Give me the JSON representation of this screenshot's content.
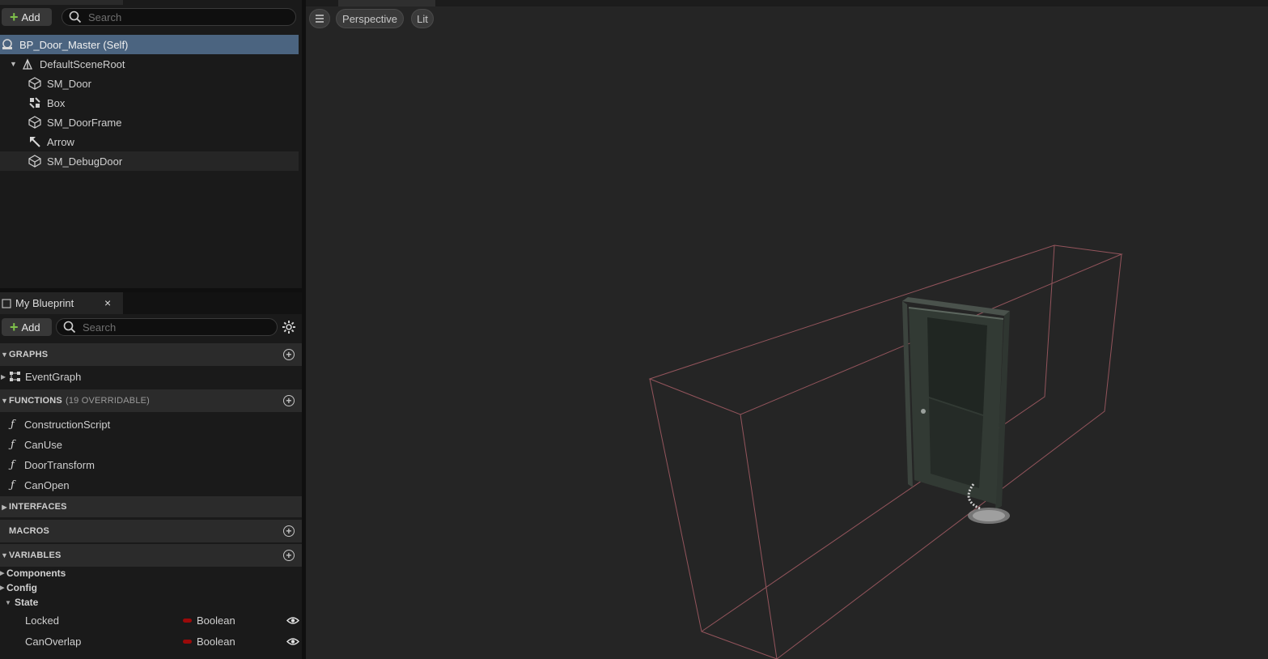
{
  "components_panel": {
    "add_label": "Add",
    "search_placeholder": "Search",
    "tree": [
      {
        "label": "BP_Door_Master (Self)",
        "icon": "actor-icon",
        "selected": true
      },
      {
        "label": "DefaultSceneRoot",
        "icon": "scene-root-icon"
      },
      {
        "label": "SM_Door",
        "icon": "static-mesh-icon"
      },
      {
        "label": "Box",
        "icon": "box-collision-icon"
      },
      {
        "label": "SM_DoorFrame",
        "icon": "static-mesh-icon"
      },
      {
        "label": "Arrow",
        "icon": "arrow-icon"
      },
      {
        "label": "SM_DebugDoor",
        "icon": "static-mesh-icon",
        "hovered": true
      }
    ]
  },
  "my_blueprint": {
    "tab_label": "My Blueprint",
    "close_glyph": "×",
    "add_label": "Add",
    "search_placeholder": "Search",
    "sections": {
      "graphs": "GRAPHS",
      "functions": "FUNCTIONS",
      "functions_note": "(19 OVERRIDABLE)",
      "interfaces": "INTERFACES",
      "macros": "MACROS",
      "variables": "VARIABLES"
    },
    "graphs": [
      "EventGraph"
    ],
    "functions": [
      "ConstructionScript",
      "CanUse",
      "DoorTransform",
      "CanOpen"
    ],
    "variable_categories": [
      "Components",
      "Config",
      "State"
    ],
    "variables": [
      {
        "name": "Locked",
        "type": "Boolean",
        "type_color": "#9b0a0a"
      },
      {
        "name": "CanOverlap",
        "type": "Boolean",
        "type_color": "#9b0a0a"
      }
    ]
  },
  "viewport": {
    "menu_icon": "hamburger-icon",
    "view_mode": "Perspective",
    "lighting": "Lit"
  },
  "colors": {
    "selection": "#4b6480",
    "panel_bg": "#1a1a1a",
    "viewport_bg": "#252525",
    "collision_box": "#b0626a",
    "add_plus": "#7ec04a"
  }
}
